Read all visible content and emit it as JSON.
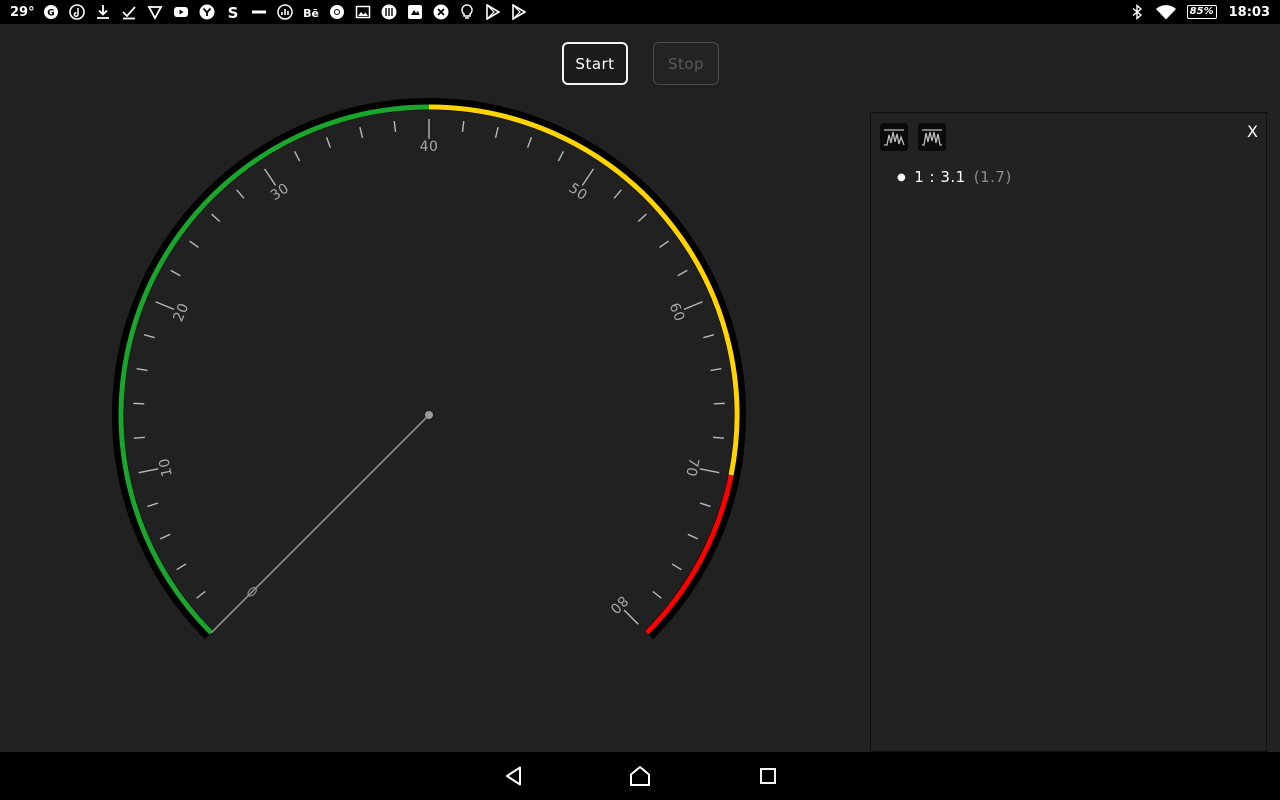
{
  "status_bar": {
    "temperature": "29°",
    "battery": "85%",
    "time": "18:03",
    "notification_icons": [
      "gmail-icon",
      "music-icon",
      "download-icon",
      "check-download-icon",
      "vpn-shield-icon",
      "youtube-icon",
      "yahoo-icon",
      "s-app-icon",
      "app-text-icon",
      "stats-icon",
      "behance-icon",
      "chrome-icon",
      "gallery-icon",
      "keyboard-icon",
      "photo-icon",
      "settings-app-icon",
      "bulb-icon",
      "play-store-icon",
      "play-store-icon"
    ],
    "right_icons": [
      "bluetooth-icon",
      "wifi-icon",
      "battery-icon"
    ]
  },
  "controls": {
    "start_label": "Start",
    "stop_label": "Stop"
  },
  "gauge": {
    "min": 0,
    "max": 80,
    "value": 0,
    "needle_value": 0,
    "major_labels": [
      "10",
      "20",
      "30",
      "40",
      "50",
      "60",
      "70",
      "80"
    ],
    "zones": [
      {
        "from": 0,
        "to": 40,
        "color": "#1aa52d"
      },
      {
        "from": 40,
        "to": 70,
        "color": "#ffd400"
      },
      {
        "from": 70,
        "to": 80,
        "color": "#ff0000"
      }
    ]
  },
  "panel": {
    "close_label": "X",
    "readings": [
      {
        "label": "1 : 3.1",
        "sub": "(1.7)"
      }
    ]
  },
  "colors": {
    "background": "#212121",
    "accent_green": "#1aa52d",
    "accent_yellow": "#ffd400",
    "accent_red": "#ff0000"
  }
}
